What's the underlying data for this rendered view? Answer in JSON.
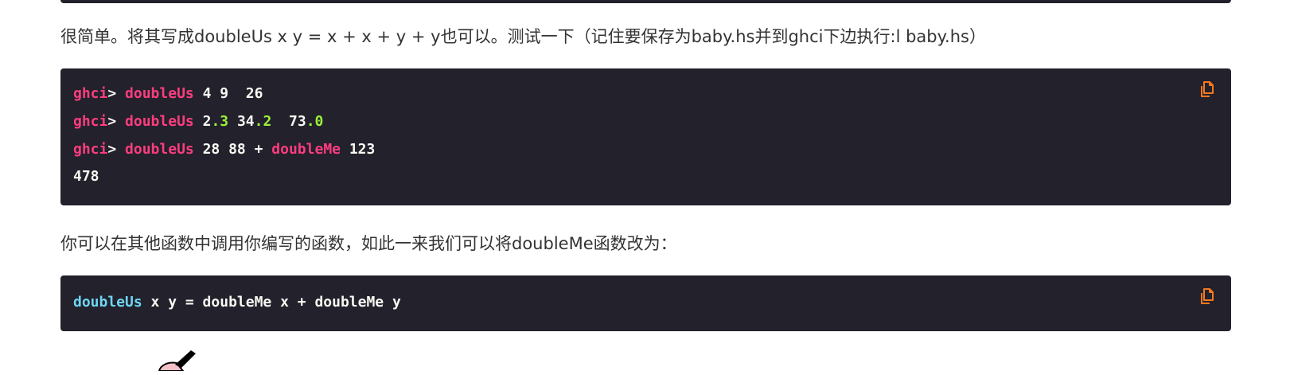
{
  "paragraphs": {
    "p1": "很简单。将其写成doubleUs x y = x + x + y + y也可以。测试一下（记住要保存为baby.hs并到ghci下边执行:l baby.hs）",
    "p2": "你可以在其他函数中调用你编写的函数，如此一来我们可以将doubleMe函数改为："
  },
  "code_block_1": {
    "lines": [
      {
        "prompt": "ghci",
        "arrow": ">",
        "fn": "doubleUs",
        "args_a": " 4 9  26"
      },
      {
        "prompt": "ghci",
        "arrow": ">",
        "fn": "doubleUs",
        "n1_int": "2",
        "n1_frac": ".3",
        "n2_int": " 34",
        "n2_frac": ".2",
        "n3_int": "  73",
        "n3_frac": ".0"
      },
      {
        "prompt": "ghci",
        "arrow": ">",
        "fn": "doubleUs",
        "mid": " 28 88 + ",
        "fn2": "doubleMe",
        "tail": " 123"
      },
      {
        "output": "478"
      }
    ]
  },
  "code_block_2": {
    "fn": "doubleUs",
    "rest": " x y = doubleMe x + doubleMe y"
  },
  "icons": {
    "copy": "copy-icon",
    "mascot": "lambda-mascot-partial"
  },
  "colors": {
    "code_bg": "#22212c",
    "keyword_pink": "#ff3d7f",
    "number_green": "#9bef3a",
    "fn_cyan": "#6fd6f2",
    "copy_orange": "#f6791e"
  }
}
